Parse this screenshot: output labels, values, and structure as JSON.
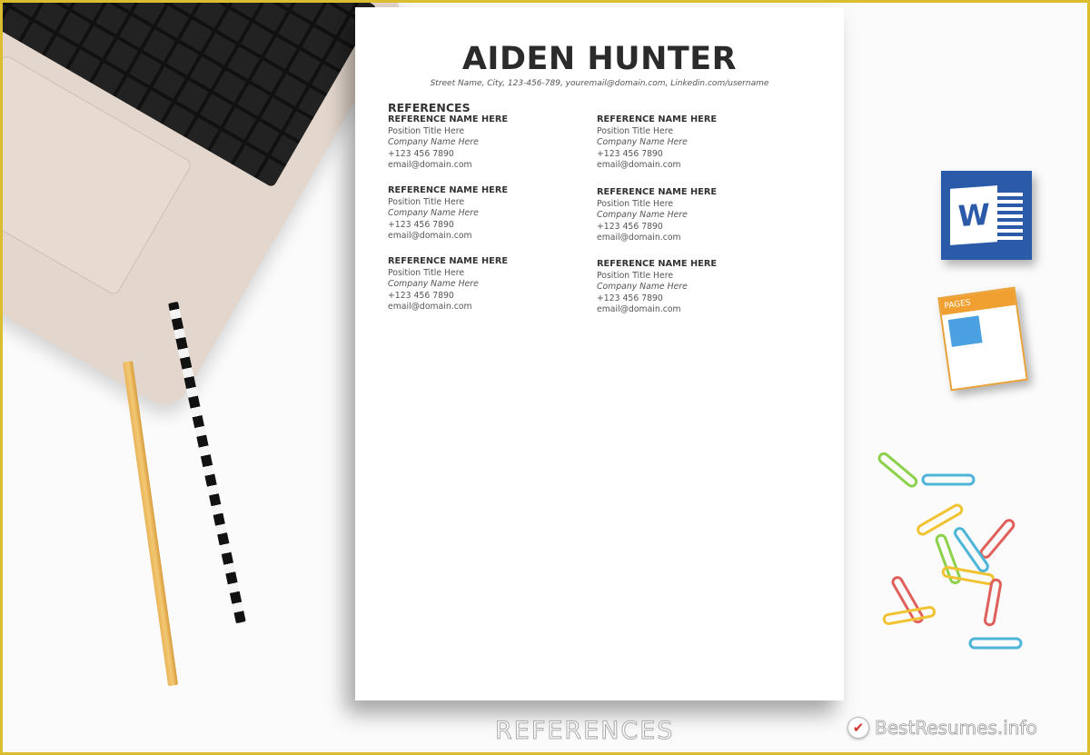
{
  "resume": {
    "name": "AIDEN HUNTER",
    "contact": "Street Name, City, 123-456-789, youremail@domain.com, Linkedin.com/username",
    "section_title": "REFERENCES",
    "references": [
      {
        "name": "REFERENCE NAME HERE",
        "position": "Position Title Here",
        "company": "Company Name Here",
        "phone": "+123 456 7890",
        "email": "email@domain.com"
      },
      {
        "name": "REFERENCE NAME HERE",
        "position": "Position Title Here",
        "company": "Company Name Here",
        "phone": "+123 456 7890",
        "email": "email@domain.com"
      },
      {
        "name": "REFERENCE NAME HERE",
        "position": "Position Title Here",
        "company": "Company Name Here",
        "phone": "+123 456 7890",
        "email": "email@domain.com"
      },
      {
        "name": "REFERENCE NAME HERE",
        "position": "Position Title Here",
        "company": "Company Name Here",
        "phone": "+123 456 7890",
        "email": "email@domain.com"
      },
      {
        "name": "REFERENCE NAME HERE",
        "position": "Position Title Here",
        "company": "Company Name Here",
        "phone": "+123 456 7890",
        "email": "email@domain.com"
      },
      {
        "name": "REFERENCE NAME HERE",
        "position": "Position Title Here",
        "company": "Company Name Here",
        "phone": "+123 456 7890",
        "email": "email@domain.com"
      }
    ]
  },
  "icons": {
    "word": {
      "letter": "W",
      "color": "#2b5aa8"
    },
    "pages": {
      "label": "PAGES",
      "color": "#f0a030"
    }
  },
  "caption": "REFERENCES",
  "watermark": "BestResumes.info",
  "frame_color": "#dcbd2e"
}
